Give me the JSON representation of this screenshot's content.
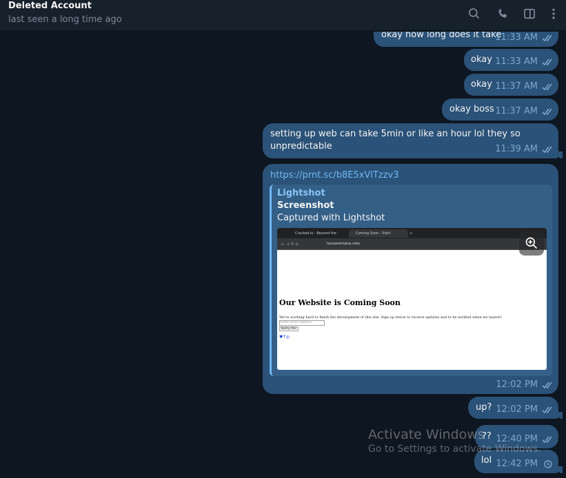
{
  "header": {
    "title": "Deleted Account",
    "status": "last seen a long time ago",
    "icons": [
      "search-icon",
      "phone-icon",
      "sidebar-toggle-icon",
      "more-vertical-icon"
    ]
  },
  "colors": {
    "background": "#0e1621",
    "header": "#17212b",
    "outgoing_bubble": "#2b5278",
    "link": "#71baf7",
    "meta": "#7da8d3"
  },
  "messages": [
    {
      "text": "okay how long does it take",
      "time": "11:33 AM",
      "status": "read"
    },
    {
      "text": "okay",
      "time": "11:33 AM",
      "status": "read"
    },
    {
      "text": "okay",
      "time": "11:37 AM",
      "status": "read"
    },
    {
      "text": "okay boss",
      "time": "11:37 AM",
      "status": "read"
    },
    {
      "text": "setting up web can take 5min or like an hour lol they so\nunpredictable",
      "time": "11:39 AM",
      "status": "read"
    },
    {
      "link": "https://prnt.sc/b8E5xVlTzzv3",
      "time": "12:02 PM",
      "status": "read",
      "preview": {
        "site": "Lightshot",
        "title": "Screenshot",
        "description": "Captured with Lightshot",
        "image": {
          "tab1": "Cracked.io - Beyond the Limits",
          "tab2": "Coming Soon - Start Bootstrap",
          "url": "houserentalus.voto",
          "heading": "Our Website is Coming Soon",
          "paragraph": "We're working hard to finish the development of this site. Sign up below to receive updates and to be notified when we launch!",
          "email_placeholder": "Enter email address...",
          "button": "Notify Me!",
          "social": "♥f◎"
        }
      }
    },
    {
      "text": "up?",
      "time": "12:02 PM",
      "status": "read"
    },
    {
      "text": "??",
      "time": "12:40 PM",
      "status": "read"
    },
    {
      "text": "lol",
      "time": "12:42 PM",
      "status": "pending"
    }
  ],
  "watermark": {
    "line1": "Activate Windows",
    "line2": "Go to Settings to activate Windows."
  }
}
